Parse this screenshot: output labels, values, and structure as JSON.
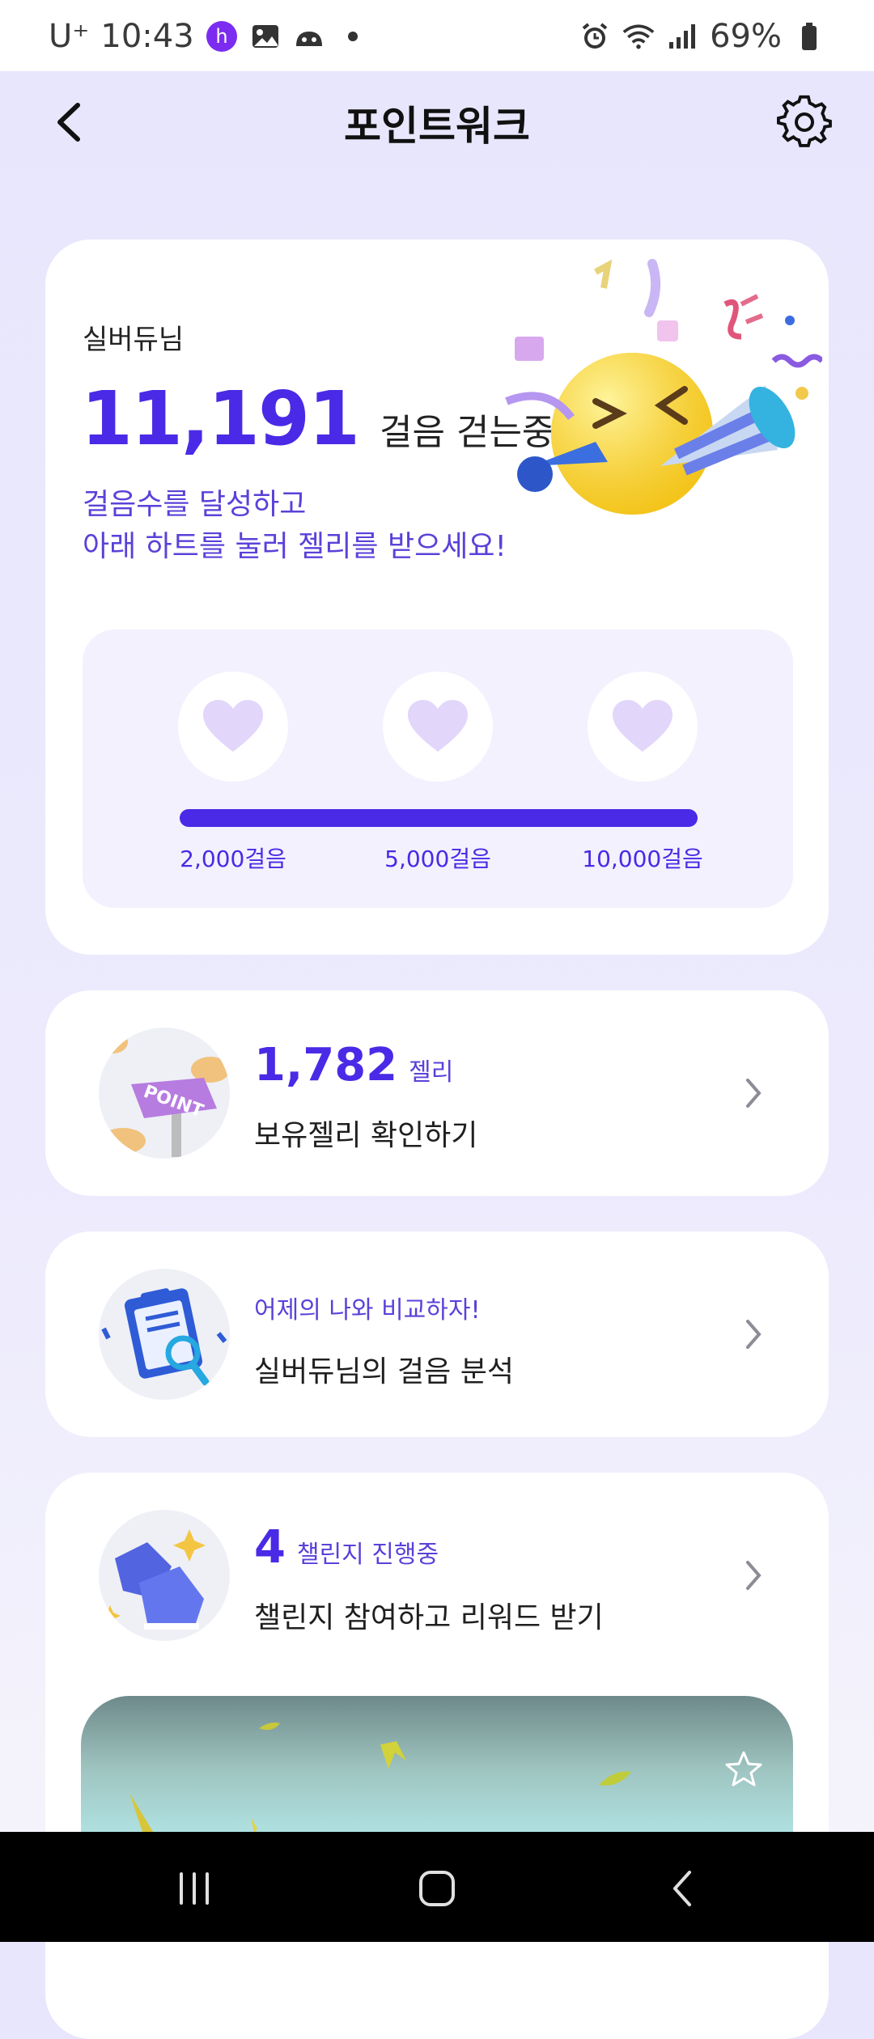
{
  "status_bar": {
    "carrier": "U⁺",
    "time": "10:43",
    "battery": "69%"
  },
  "header": {
    "title": "포인트워크"
  },
  "steps_card": {
    "nickname": "실버듀님",
    "step_count": "11,191",
    "step_suffix": "걸음 걷는중",
    "promo_line1": "걸음수를 달성하고",
    "promo_line2": "아래 하트를 눌러 젤리를 받으세요!",
    "milestones": [
      "2,000걸음",
      "5,000걸음",
      "10,000걸음"
    ],
    "progress_fraction": 1.0,
    "accent_color": "#4a2ae6",
    "heart_color": "#e2d6fb"
  },
  "jelly_card": {
    "count": "1,782",
    "unit": "젤리",
    "action": "보유젤리 확인하기"
  },
  "analysis_card": {
    "subtitle": "어제의 나와 비교하자!",
    "action": "실버듀님의 걸음 분석"
  },
  "challenge_card": {
    "count": "4",
    "unit": "챌린지 진행중",
    "action": "챌린지 참여하고 리워드 받기"
  },
  "icons": [
    "back-icon",
    "gear-icon",
    "heart-icon",
    "chevron-right-icon",
    "star-icon",
    "recents-icon",
    "home-icon",
    "nav-back-icon"
  ]
}
